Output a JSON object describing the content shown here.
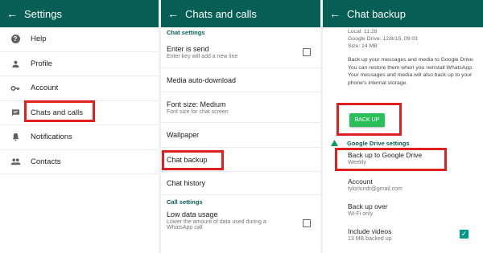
{
  "settings": {
    "title": "Settings",
    "items": [
      {
        "label": "Help",
        "icon": "help-icon"
      },
      {
        "label": "Profile",
        "icon": "person-icon"
      },
      {
        "label": "Account",
        "icon": "key-icon"
      },
      {
        "label": "Chats and calls",
        "icon": "chat-icon"
      },
      {
        "label": "Notifications",
        "icon": "bell-icon"
      },
      {
        "label": "Contacts",
        "icon": "group-icon"
      }
    ]
  },
  "chats": {
    "title": "Chats and calls",
    "chat_settings_header": "Chat settings",
    "enter_is_send": {
      "title": "Enter is send",
      "desc": "Enter key will add a new line"
    },
    "media_auto_download": "Media auto-download",
    "font_size": {
      "title": "Font size: Medium",
      "desc": "Font size for chat screen"
    },
    "wallpaper": "Wallpaper",
    "chat_backup": "Chat backup",
    "chat_history": "Chat history",
    "call_settings_header": "Call settings",
    "low_data_usage": {
      "title": "Low data usage",
      "desc": "Lower the amount of data used during a WhatsApp call"
    }
  },
  "backup": {
    "title": "Chat backup",
    "local": "Local: 11:28",
    "google_drive_time": "Google Drive: 12/8/15, 09:03",
    "size": "Size: 14 MB",
    "description": "Back up your messages and media to Google Drive. You can restore them when you reinstall WhatsApp. Your messages and media will also back up to your phone's internal storage.",
    "back_up_button": "BACK UP",
    "gd_settings_header": "Google Drive settings",
    "back_up_to_gd": {
      "title": "Back up to Google Drive",
      "desc": "Weekly"
    },
    "account": {
      "title": "Account",
      "desc": "tylorlundr@gmail.com"
    },
    "back_up_over": {
      "title": "Back up over",
      "desc": "Wi-Fi only"
    },
    "include_videos": {
      "title": "Include videos",
      "desc": "13 MB backed up"
    }
  },
  "colors": {
    "toolbar": "#075e54",
    "accent": "#075e54",
    "button": "#2bbf5c",
    "highlight": "#e0201f",
    "checkbox_checked": "#009688"
  }
}
